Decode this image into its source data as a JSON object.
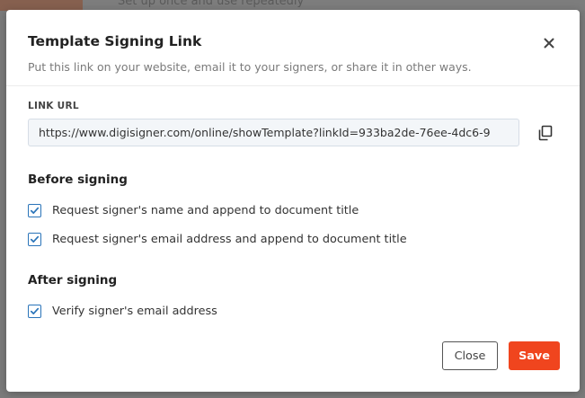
{
  "background": {
    "partial_text": "Set up once and use repeatedly"
  },
  "modal": {
    "title": "Template Signing Link",
    "subtitle": "Put this link on your website, email it to your signers, or share it in other ways.",
    "close_icon": "close-icon"
  },
  "link": {
    "label": "LINK URL",
    "value": "https://www.digisigner.com/online/showTemplate?linkId=933ba2de-76ee-4dc6-9",
    "copy_icon": "copy-icon"
  },
  "before_signing": {
    "title": "Before signing",
    "options": [
      {
        "label": "Request signer's name and append to document title",
        "checked": true
      },
      {
        "label": "Request signer's email address and append to document title",
        "checked": true
      }
    ]
  },
  "after_signing": {
    "title": "After signing",
    "options": [
      {
        "label": "Verify signer's email address",
        "checked": true
      }
    ]
  },
  "footer": {
    "close_label": "Close",
    "save_label": "Save"
  },
  "colors": {
    "accent": "#2a74b9",
    "save_button": "#f0451e",
    "overlay": "#7b7b7b"
  }
}
